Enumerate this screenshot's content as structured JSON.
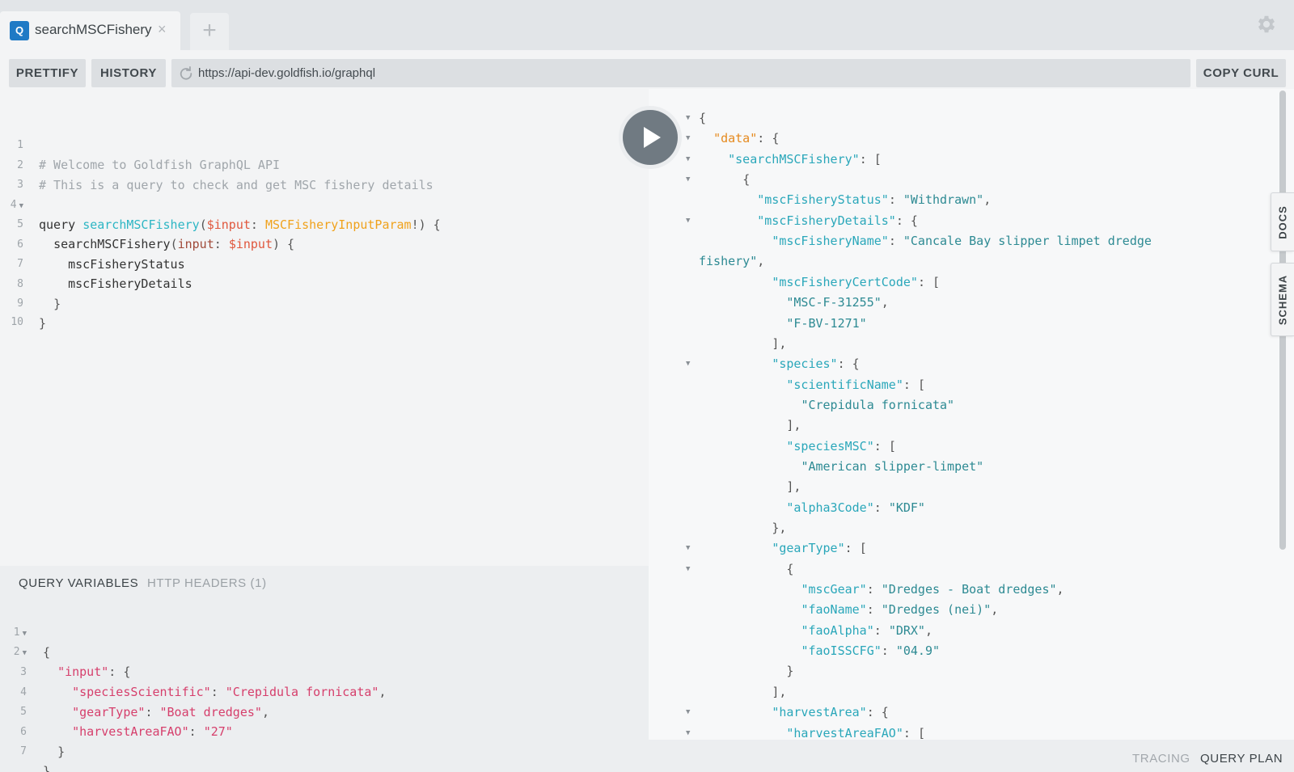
{
  "tab": {
    "badge": "Q",
    "title": "searchMSCFishery",
    "close": "×",
    "add": "+"
  },
  "toolbar": {
    "prettify": "PRETTIFY",
    "history": "HISTORY",
    "url": "https://api-dev.goldfish.io/graphql",
    "copy_curl": "COPY CURL"
  },
  "query_editor": {
    "line_numbers": [
      "1",
      "2",
      "3",
      "4",
      "5",
      "6",
      "7",
      "8",
      "9",
      "10"
    ],
    "comment1": "# Welcome to Goldfish GraphQL API",
    "comment2": "# This is a query to check and get MSC fishery details",
    "kw_query": "query",
    "op_name": "searchMSCFishery",
    "paren_open": "(",
    "var_input": "$input",
    "colon": ": ",
    "type_name": "MSCFisheryInputParam",
    "type_suffix": "!) {",
    "field_root": "searchMSCFishery",
    "arg_name": "input",
    "arg_colon": ": ",
    "arg_var": "$input",
    "arg_close": ") {",
    "field_status": "mscFisheryStatus",
    "field_details": "mscFisheryDetails",
    "brace_close_inner": "}",
    "brace_close_outer": "}"
  },
  "variables_panel": {
    "tab_active": "QUERY VARIABLES",
    "tab_inactive": "HTTP HEADERS (1)",
    "line_numbers": [
      "1",
      "2",
      "3",
      "4",
      "5",
      "6",
      "7"
    ],
    "open": "{",
    "k_input": "\"input\"",
    "k_species": "\"speciesScientific\"",
    "v_species": "\"Crepidula fornicata\"",
    "k_gear": "\"gearType\"",
    "v_gear": "\"Boat dredges\"",
    "k_harvest": "\"harvestAreaFAO\"",
    "v_harvest": "\"27\"",
    "close_inner": "}",
    "close_outer": "}"
  },
  "result": {
    "lines": [
      {
        "indent": "",
        "k": "",
        "sep": "",
        "v": "{",
        "arrow": true
      },
      {
        "indent": "  ",
        "k": "\"data\"",
        "sep": ": ",
        "v": "{",
        "arrow": true,
        "data": true
      },
      {
        "indent": "    ",
        "k": "\"searchMSCFishery\"",
        "sep": ": ",
        "v": "[",
        "arrow": true
      },
      {
        "indent": "      ",
        "k": "",
        "sep": "",
        "v": "{",
        "arrow": true
      },
      {
        "indent": "        ",
        "k": "\"mscFisheryStatus\"",
        "sep": ": ",
        "s": "\"Withdrawn\"",
        "v": ",",
        "arrow": false
      },
      {
        "indent": "        ",
        "k": "\"mscFisheryDetails\"",
        "sep": ": ",
        "v": "{",
        "arrow": true
      },
      {
        "indent": "          ",
        "k": "\"mscFisheryName\"",
        "sep": ": ",
        "s": "\"Cancale Bay slipper limpet dredge",
        "v": "",
        "arrow": false
      },
      {
        "indent": "",
        "k": "",
        "sep": "",
        "s": "fishery\"",
        "v": ",",
        "arrow": false
      },
      {
        "indent": "          ",
        "k": "\"mscFisheryCertCode\"",
        "sep": ": ",
        "v": "[",
        "arrow": false
      },
      {
        "indent": "            ",
        "k": "",
        "sep": "",
        "s": "\"MSC-F-31255\"",
        "v": ",",
        "arrow": false
      },
      {
        "indent": "            ",
        "k": "",
        "sep": "",
        "s": "\"F-BV-1271\"",
        "v": "",
        "arrow": false
      },
      {
        "indent": "          ",
        "k": "",
        "sep": "",
        "v": "],",
        "arrow": false
      },
      {
        "indent": "          ",
        "k": "\"species\"",
        "sep": ": ",
        "v": "{",
        "arrow": true
      },
      {
        "indent": "            ",
        "k": "\"scientificName\"",
        "sep": ": ",
        "v": "[",
        "arrow": false
      },
      {
        "indent": "              ",
        "k": "",
        "sep": "",
        "s": "\"Crepidula fornicata\"",
        "v": "",
        "arrow": false
      },
      {
        "indent": "            ",
        "k": "",
        "sep": "",
        "v": "],",
        "arrow": false
      },
      {
        "indent": "            ",
        "k": "\"speciesMSC\"",
        "sep": ": ",
        "v": "[",
        "arrow": false
      },
      {
        "indent": "              ",
        "k": "",
        "sep": "",
        "s": "\"American slipper-limpet\"",
        "v": "",
        "arrow": false
      },
      {
        "indent": "            ",
        "k": "",
        "sep": "",
        "v": "],",
        "arrow": false
      },
      {
        "indent": "            ",
        "k": "\"alpha3Code\"",
        "sep": ": ",
        "s": "\"KDF\"",
        "v": "",
        "arrow": false
      },
      {
        "indent": "          ",
        "k": "",
        "sep": "",
        "v": "},",
        "arrow": false
      },
      {
        "indent": "          ",
        "k": "\"gearType\"",
        "sep": ": ",
        "v": "[",
        "arrow": true
      },
      {
        "indent": "            ",
        "k": "",
        "sep": "",
        "v": "{",
        "arrow": true
      },
      {
        "indent": "              ",
        "k": "\"mscGear\"",
        "sep": ": ",
        "s": "\"Dredges - Boat dredges\"",
        "v": ",",
        "arrow": false
      },
      {
        "indent": "              ",
        "k": "\"faoName\"",
        "sep": ": ",
        "s": "\"Dredges (nei)\"",
        "v": ",",
        "arrow": false
      },
      {
        "indent": "              ",
        "k": "\"faoAlpha\"",
        "sep": ": ",
        "s": "\"DRX\"",
        "v": ",",
        "arrow": false
      },
      {
        "indent": "              ",
        "k": "\"faoISSCFG\"",
        "sep": ": ",
        "s": "\"04.9\"",
        "v": "",
        "arrow": false
      },
      {
        "indent": "            ",
        "k": "",
        "sep": "",
        "v": "}",
        "arrow": false
      },
      {
        "indent": "          ",
        "k": "",
        "sep": "",
        "v": "],",
        "arrow": false
      },
      {
        "indent": "          ",
        "k": "\"harvestArea\"",
        "sep": ": ",
        "v": "{",
        "arrow": true
      },
      {
        "indent": "            ",
        "k": "\"harvestAreaFAO\"",
        "sep": ": ",
        "v": "[",
        "arrow": true
      }
    ]
  },
  "side_tabs": {
    "docs": "DOCS",
    "schema": "SCHEMA"
  },
  "footer": {
    "tracing": "TRACING",
    "query_plan": "QUERY PLAN"
  },
  "icons": {
    "settings": "gear-icon",
    "refresh": "refresh-icon",
    "play": "play-icon"
  },
  "colors": {
    "tab_badge": "#1f7ac5",
    "play_button": "#707a82",
    "result_key": "#2aa7ba",
    "data_key": "#e58a1f",
    "var_key": "#d63f6c"
  }
}
